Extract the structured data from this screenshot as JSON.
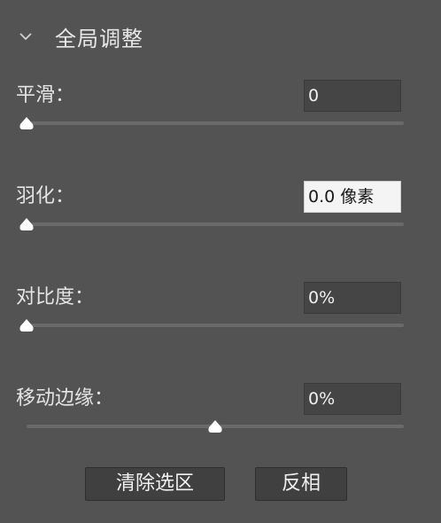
{
  "section": {
    "title": "全局调整",
    "expanded": true
  },
  "controls": [
    {
      "id": "smooth",
      "label": "平滑：",
      "value": "0",
      "slider": 0.0,
      "highlight": false
    },
    {
      "id": "feather",
      "label": "羽化：",
      "value": "0.0 像素",
      "slider": 0.0,
      "highlight": true
    },
    {
      "id": "contrast",
      "label": "对比度：",
      "value": "0%",
      "slider": 0.0,
      "highlight": false
    },
    {
      "id": "shift",
      "label": "移动边缘：",
      "value": "0%",
      "slider": 0.5,
      "highlight": false
    }
  ],
  "buttons": {
    "clear": "清除选区",
    "invert": "反相"
  },
  "colors": {
    "panel": "#535353",
    "field": "#454545",
    "track": "#6a6a6a",
    "thumb": "#ffffff"
  }
}
